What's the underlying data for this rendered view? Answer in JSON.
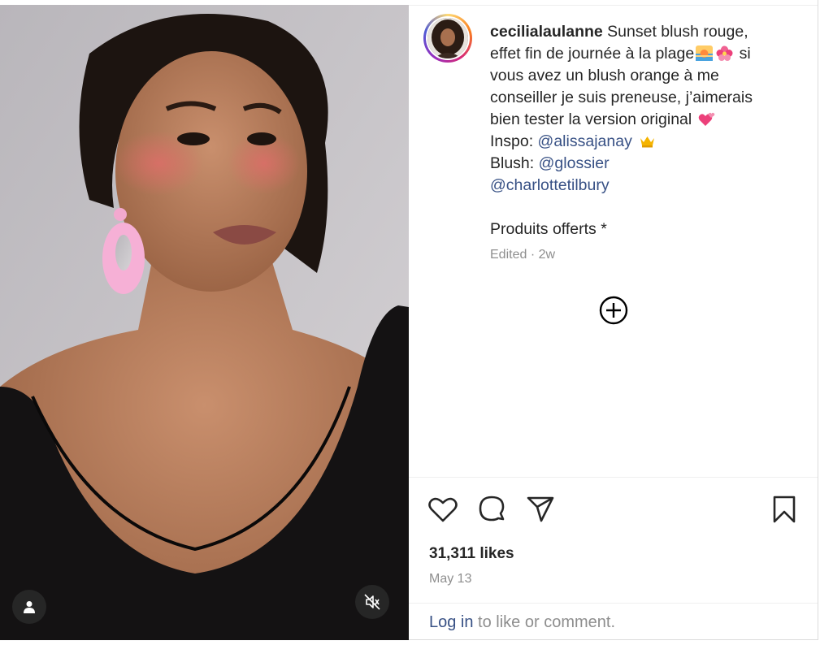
{
  "post": {
    "username": "cecilialaulanne",
    "caption_line1": " Sunset blush rouge, effet fin de journée à la plage",
    "caption_line1_after": " si vous avez un blush orange à me conseiller je suis preneuse, j’aimerais bien tester la version original ",
    "inspo_label": "Inspo: ",
    "inspo_mention": "@alissajanay",
    "blush_label": "Blush: ",
    "blush_mention1": "@glossier",
    "blush_mention2": "@charlottetilbury",
    "gifted_note": "Produits offerts *",
    "edited_label": "Edited",
    "meta_separator": " · ",
    "age": "2w",
    "likes": "31,311 likes",
    "date": "May 13"
  },
  "footer": {
    "login_link": "Log in",
    "login_text": " to like or comment."
  },
  "icons": {
    "like": "heart-icon",
    "comment": "comment-icon",
    "share": "send-icon",
    "save": "bookmark-icon",
    "more": "add-circle-icon",
    "tag": "user-tag-icon",
    "mute": "volume-muted-icon",
    "emoji1": "sunrise-emoji",
    "emoji2": "hibiscus-emoji",
    "emoji3": "two-hearts-emoji",
    "emoji4": "crown-emoji"
  },
  "colors": {
    "link": "#385185",
    "muted_text": "#8e8e8e",
    "text": "#262626",
    "divider": "#efefef"
  }
}
